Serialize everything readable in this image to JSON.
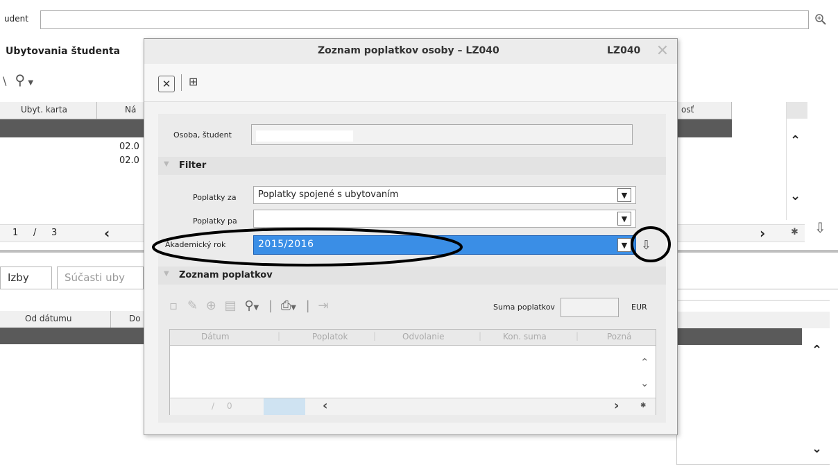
{
  "background": {
    "student_label": "udent",
    "section_title": "Ubytovania študenta",
    "toolbar_run_icon": "run-icon",
    "grid_headers": [
      "Ubyt. karta",
      "Ná",
      "osť"
    ],
    "grid_dates": [
      "02.0",
      "02.0"
    ],
    "pager": {
      "current": "1",
      "separator": "/",
      "total": "3"
    },
    "tabs": [
      "Izby",
      "Súčasti uby"
    ],
    "lower_grid_headers": [
      "Od dátumu",
      "Do"
    ]
  },
  "dialog": {
    "title": "Zoznam poplatkov osoby – LZ040",
    "code": "LZ040",
    "osoba_label": "Osoba, študent",
    "filter_label": "Filter",
    "poplatky_za_label": "Poplatky za",
    "poplatky_za_value": "Poplatky spojené s ubytovaním",
    "poplatky_pa_label": "Poplatky pa",
    "akad_rok_label": "Akademický rok",
    "akad_rok_value": "2015/2016",
    "zoznam_label": "Zoznam poplatkov",
    "suma_label": "Suma poplatkov",
    "currency": "EUR",
    "fee_headers": [
      "Dátum",
      "Poplatok",
      "Odvolanie",
      "Kon. suma",
      "Pozná"
    ],
    "fee_pager": {
      "separator": "/",
      "value": "0",
      "current": "0"
    }
  },
  "annotation_color": "#000000",
  "selection_color": "#3a8ee6"
}
